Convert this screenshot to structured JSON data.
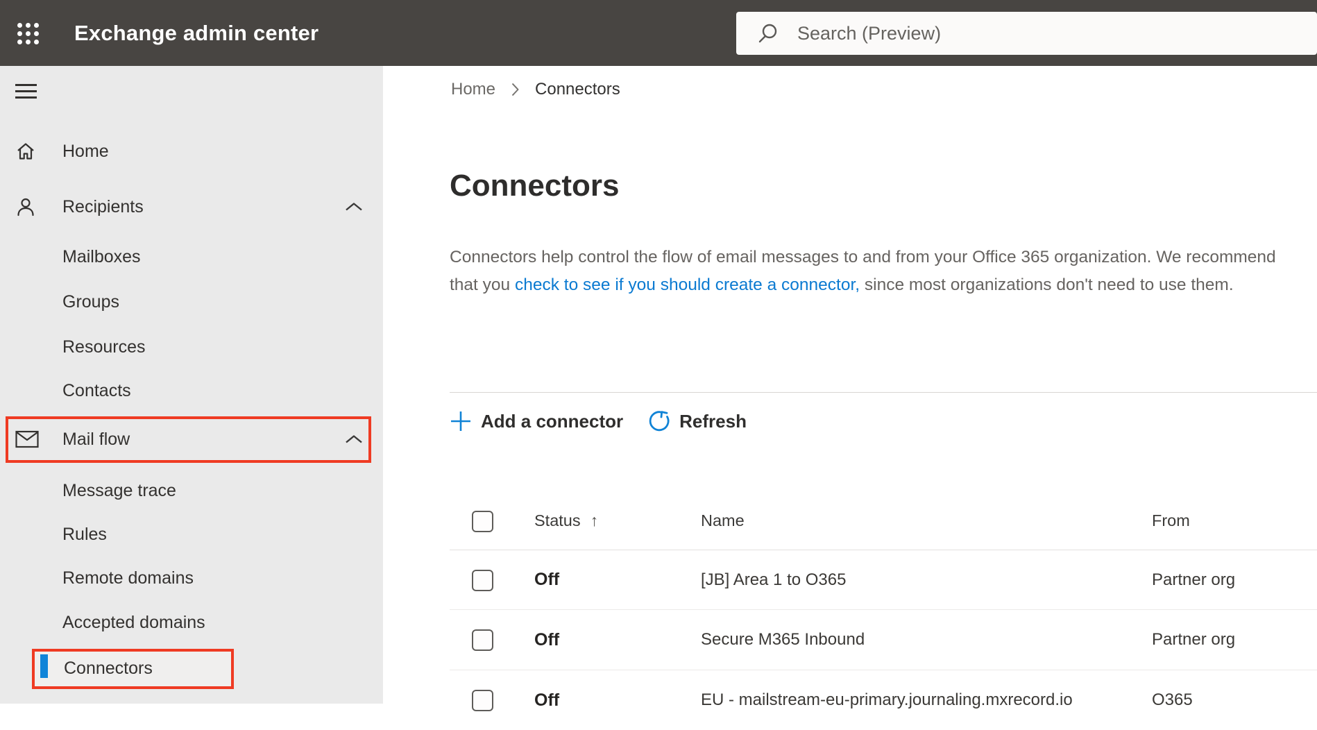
{
  "topbar": {
    "app_title": "Exchange admin center",
    "search_placeholder": "Search (Preview)"
  },
  "sidebar": {
    "items": [
      {
        "label": "Home"
      },
      {
        "label": "Recipients"
      },
      {
        "label": "Mailboxes"
      },
      {
        "label": "Groups"
      },
      {
        "label": "Resources"
      },
      {
        "label": "Contacts"
      },
      {
        "label": "Mail flow"
      },
      {
        "label": "Message trace"
      },
      {
        "label": "Rules"
      },
      {
        "label": "Remote domains"
      },
      {
        "label": "Accepted domains"
      },
      {
        "label": "Connectors"
      }
    ]
  },
  "breadcrumb": {
    "home": "Home",
    "current": "Connectors"
  },
  "page": {
    "title": "Connectors",
    "desc_before_link": "Connectors help control the flow of email messages to and from your Office 365 organization. We recommend that you ",
    "desc_link": "check to see if you should create a connector,",
    "desc_after_link": " since most organizations don't need to use them."
  },
  "toolbar": {
    "add_label": "Add a connector",
    "refresh_label": "Refresh"
  },
  "table": {
    "columns": {
      "status": "Status",
      "name": "Name",
      "from": "From"
    },
    "sort_icon": "↑",
    "rows": [
      {
        "status": "Off",
        "name": "[JB] Area 1 to O365",
        "from": "Partner org"
      },
      {
        "status": "Off",
        "name": "Secure M365 Inbound",
        "from": "Partner org"
      },
      {
        "status": "Off",
        "name": "EU - mailstream-eu-primary.journaling.mxrecord.io",
        "from": "O365"
      }
    ]
  },
  "colors": {
    "topbar_bg": "#484542",
    "sidebar_bg": "#eaeaea",
    "annotation_red": "#ef3b23",
    "accent_blue": "#0b7ad1",
    "selection_bar_blue": "#1084d8"
  }
}
